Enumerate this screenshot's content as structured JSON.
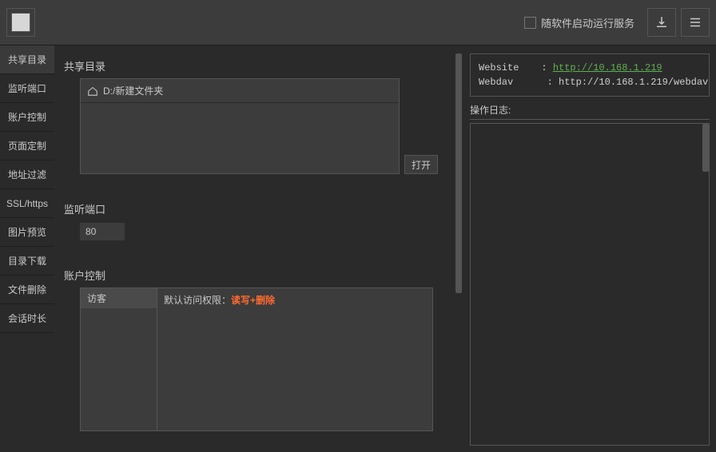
{
  "topbar": {
    "checkbox_label": "随软件启动运行服务"
  },
  "sidebar": {
    "items": [
      {
        "label": "共享目录"
      },
      {
        "label": "监听端口"
      },
      {
        "label": "账户控制"
      },
      {
        "label": "页面定制"
      },
      {
        "label": "地址过滤"
      },
      {
        "label": "SSL/https"
      },
      {
        "label": "图片预览"
      },
      {
        "label": "目录下载"
      },
      {
        "label": "文件删除"
      },
      {
        "label": "会话时长"
      }
    ]
  },
  "sections": {
    "share": {
      "title": "共享目录",
      "path": "D:/新建文件夹",
      "open_label": "打开"
    },
    "port": {
      "title": "监听端口",
      "value": "80"
    },
    "account": {
      "title": "账户控制",
      "list": [
        {
          "name": "访客"
        }
      ],
      "perm_label": "默认访问权限：",
      "perm_value": "读写+删除"
    }
  },
  "right": {
    "info": {
      "website_key": "Website",
      "website_sep": "  : ",
      "website_url": "http://10.168.1.219",
      "webdav_key": "Webdav",
      "webdav_sep": "   : ",
      "webdav_url": "http://10.168.1.219/webdav"
    },
    "log_label": "操作日志:"
  }
}
